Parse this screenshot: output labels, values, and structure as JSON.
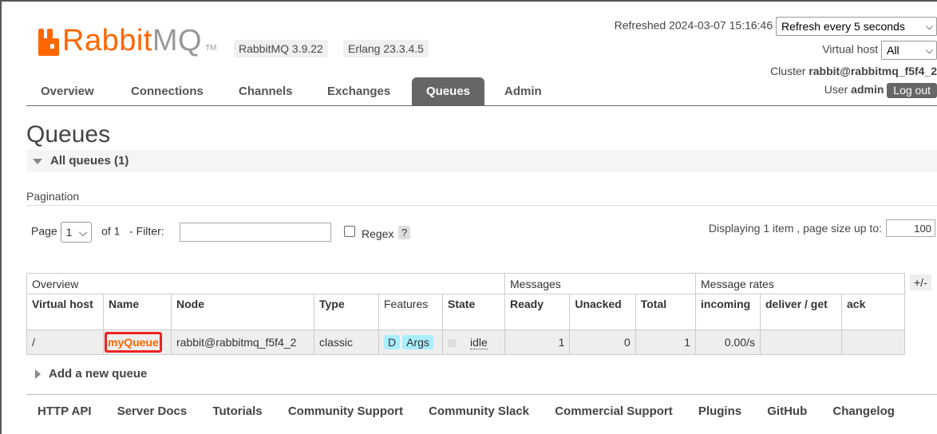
{
  "brand": {
    "rabbit": "Rabbit",
    "mq": "MQ",
    "tm": "TM",
    "color": "#ff6600"
  },
  "versions": {
    "rabbitmq": "RabbitMQ 3.9.22",
    "erlang": "Erlang 23.3.4.5"
  },
  "header": {
    "refreshed_label": "Refreshed 2024-03-07 15:16:46",
    "refresh_select": "Refresh every 5 seconds",
    "vhost_label": "Virtual host",
    "vhost_select": "All",
    "cluster_label": "Cluster",
    "cluster_value": "rabbit@rabbitmq_f5f4_2",
    "user_label": "User",
    "user_value": "admin",
    "logout": "Log out"
  },
  "tabs": [
    "Overview",
    "Connections",
    "Channels",
    "Exchanges",
    "Queues",
    "Admin"
  ],
  "active_tab": "Queues",
  "page_title": "Queues",
  "section": {
    "title": "All queues (1)"
  },
  "pagination": {
    "label": "Pagination",
    "page_label": "Page",
    "page_value": "1",
    "of_label": "of 1",
    "filter_label": "- Filter:",
    "filter_value": "",
    "regex_label": "Regex",
    "help": "?",
    "display_label": "Displaying 1 item , page size up to:",
    "page_size": "100"
  },
  "table": {
    "groups": [
      "Overview",
      "Messages",
      "Message rates"
    ],
    "plusminus": "+/-",
    "columns": [
      "Virtual host",
      "Name",
      "Node",
      "Type",
      "Features",
      "State",
      "Ready",
      "Unacked",
      "Total",
      "incoming",
      "deliver / get",
      "ack"
    ],
    "row": {
      "vhost": "/",
      "name": "myQueue",
      "node": "rabbit@rabbitmq_f5f4_2",
      "type": "classic",
      "features": [
        "D",
        "Args"
      ],
      "state": "idle",
      "ready": "1",
      "unacked": "0",
      "total": "1",
      "incoming": "0.00/s",
      "deliver_get": "",
      "ack": ""
    }
  },
  "add_queue": "Add a new queue",
  "footer": [
    "HTTP API",
    "Server Docs",
    "Tutorials",
    "Community Support",
    "Community Slack",
    "Commercial Support",
    "Plugins",
    "GitHub",
    "Changelog"
  ]
}
